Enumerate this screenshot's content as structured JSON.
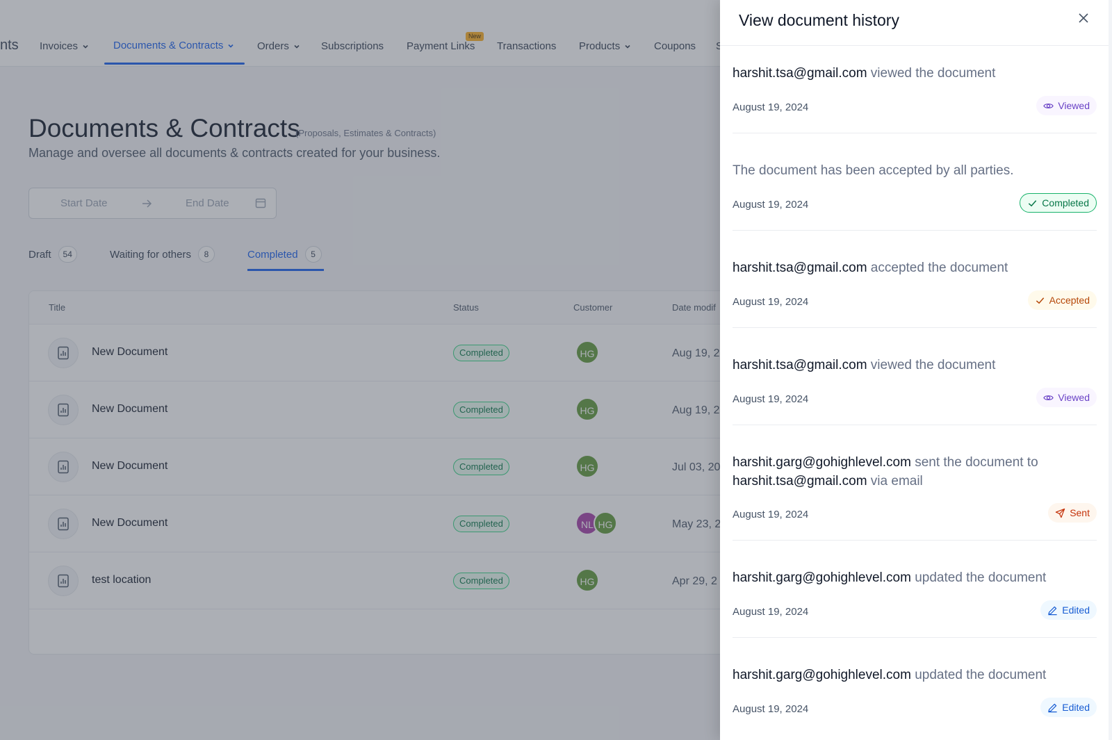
{
  "nav": {
    "partial_left": "nts",
    "items": [
      {
        "label": "Invoices"
      },
      {
        "label": "Documents & Contracts"
      },
      {
        "label": "Orders"
      },
      {
        "label": "Subscriptions"
      },
      {
        "label": "Payment Links"
      },
      {
        "label": "Transactions"
      },
      {
        "label": "Products"
      },
      {
        "label": "Coupons"
      },
      {
        "label": "S"
      }
    ],
    "new_badge": "New"
  },
  "page": {
    "title": "Documents & Contracts",
    "title_sub": "(Proposals, Estimates & Contracts)",
    "description": "Manage and oversee all documents & contracts created for your business."
  },
  "date_range": {
    "start_placeholder": "Start Date",
    "end_placeholder": "End Date"
  },
  "tabs": [
    {
      "label": "Draft",
      "count": "54"
    },
    {
      "label": "Waiting for others",
      "count": "8"
    },
    {
      "label": "Completed",
      "count": "5"
    }
  ],
  "table": {
    "headers": {
      "title": "Title",
      "status": "Status",
      "customer": "Customer",
      "date": "Date modif"
    },
    "rows": [
      {
        "title": "New Document",
        "status": "Completed",
        "avatars": [
          "HG"
        ],
        "date": "Aug 19, 2"
      },
      {
        "title": "New Document",
        "status": "Completed",
        "avatars": [
          "HG"
        ],
        "date": "Aug 19, 2"
      },
      {
        "title": "New Document",
        "status": "Completed",
        "avatars": [
          "HG"
        ],
        "date": "Jul 03, 20"
      },
      {
        "title": "New Document",
        "status": "Completed",
        "avatars": [
          "NL",
          "HG"
        ],
        "date": "May 23, 2"
      },
      {
        "title": "test location",
        "status": "Completed",
        "avatars": [
          "HG"
        ],
        "date": "Apr 29, 2"
      }
    ]
  },
  "drawer": {
    "title": "View document history",
    "entries": [
      {
        "who": "harshit.tsa@gmail.com",
        "action": " viewed the document",
        "date": "August 19, 2024",
        "badge": "Viewed"
      },
      {
        "action": "The document has been accepted by all parties.",
        "date": "August 19, 2024",
        "badge": "Completed"
      },
      {
        "who": "harshit.tsa@gmail.com",
        "action": " accepted the document",
        "date": "August 19, 2024",
        "badge": "Accepted"
      },
      {
        "who": "harshit.tsa@gmail.com",
        "action": " viewed the document",
        "date": "August 19, 2024",
        "badge": "Viewed"
      },
      {
        "who": "harshit.garg@gohighlevel.com",
        "action": " sent the document to ",
        "who2": "harshit.tsa@gmail.com",
        "action2": " via email",
        "date": "August 19, 2024",
        "badge": "Sent"
      },
      {
        "who": "harshit.garg@gohighlevel.com",
        "action": " updated the document",
        "date": "August 19, 2024",
        "badge": "Edited"
      },
      {
        "who": "harshit.garg@gohighlevel.com",
        "action": " updated the document",
        "date": "August 19, 2024",
        "badge": "Edited"
      }
    ]
  },
  "colors": {
    "primary": "#155eef",
    "avatar_hg": "#5f9a3a",
    "avatar_nl": "#a43ea8",
    "viewed": "#6941c6",
    "completed": "#067647",
    "accepted": "#b54708",
    "sent": "#c4320a",
    "edited": "#175cd3"
  },
  "icons": {
    "viewed": "eye-icon",
    "completed": "check-icon",
    "accepted": "check-icon",
    "sent": "send-icon",
    "edited": "pencil-icon",
    "close": "close-icon",
    "document": "document-chart-icon"
  }
}
